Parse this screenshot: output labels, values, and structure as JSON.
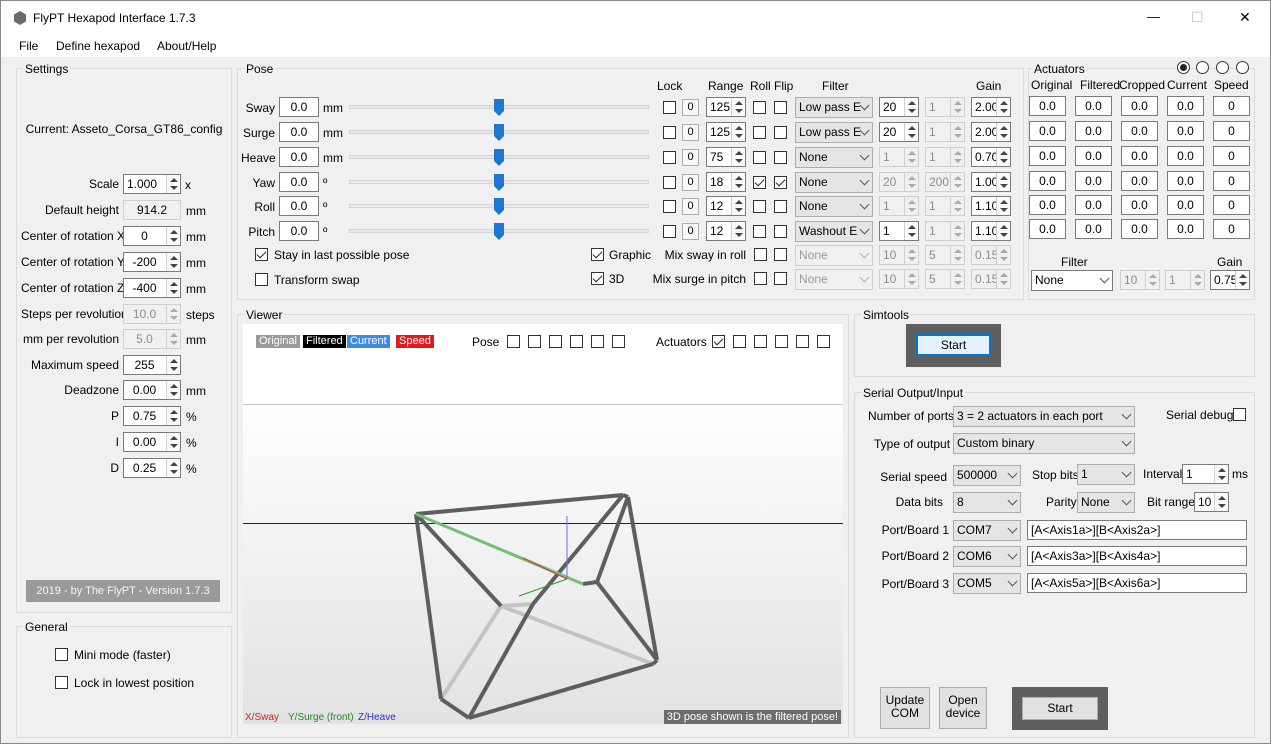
{
  "window": {
    "title": "FlyPT Hexapod Interface 1.7.3",
    "controls": {
      "minimize": "—",
      "maximize": "☐",
      "close": "✕"
    }
  },
  "menu": [
    "File",
    "Define hexapod",
    "About/Help"
  ],
  "settings": {
    "group_label": "Settings",
    "current": "Current: Asseto_Corsa_GT86_config",
    "scale": {
      "label": "Scale",
      "value": "1.000",
      "unit": "x"
    },
    "default_height": {
      "label": "Default height",
      "value": "914.2",
      "unit": "mm"
    },
    "cor_x": {
      "label": "Center of rotation X",
      "value": "0",
      "unit": "mm"
    },
    "cor_y": {
      "label": "Center of rotation Y",
      "value": "-200",
      "unit": "mm"
    },
    "cor_z": {
      "label": "Center of rotation Z",
      "value": "-400",
      "unit": "mm"
    },
    "steps": {
      "label": "Steps per revolution",
      "value": "10.0",
      "unit": "steps"
    },
    "mm_rev": {
      "label": "mm per revolution",
      "value": "5.0",
      "unit": "mm"
    },
    "max_speed": {
      "label": "Maximum speed",
      "value": "255",
      "unit": ""
    },
    "deadzone": {
      "label": "Deadzone",
      "value": "0.00",
      "unit": "mm"
    },
    "p": {
      "label": "P",
      "value": "0.75",
      "unit": "%"
    },
    "i": {
      "label": "I",
      "value": "0.00",
      "unit": "%"
    },
    "d": {
      "label": "D",
      "value": "0.25",
      "unit": "%"
    },
    "footer": "2019 - by The FlyPT - Version 1.7.3"
  },
  "general": {
    "group_label": "General",
    "mini_mode": "Mini mode (faster)",
    "lock_lowest": "Lock in lowest position"
  },
  "pose": {
    "group_label": "Pose",
    "headers": {
      "lock": "Lock",
      "range": "Range",
      "roll": "Roll",
      "flip": "Flip",
      "filter": "Filter",
      "gain": "Gain"
    },
    "rows": [
      {
        "name": "Sway",
        "value": "0.0",
        "unit": "mm",
        "lock": "0",
        "range": "125",
        "roll": false,
        "flip": false,
        "filter": "Low pass E",
        "f1": "20",
        "f2": "1",
        "gain": "2.00",
        "f1_dis": false
      },
      {
        "name": "Surge",
        "value": "0.0",
        "unit": "mm",
        "lock": "0",
        "range": "125",
        "roll": false,
        "flip": false,
        "filter": "Low pass E",
        "f1": "20",
        "f2": "1",
        "gain": "2.00",
        "f1_dis": false
      },
      {
        "name": "Heave",
        "value": "0.0",
        "unit": "mm",
        "lock": "0",
        "range": "75",
        "roll": false,
        "flip": false,
        "filter": "None",
        "f1": "1",
        "f2": "1",
        "gain": "0.70",
        "f1_dis": true
      },
      {
        "name": "Yaw",
        "value": "0.0",
        "unit": "º",
        "lock": "0",
        "range": "18",
        "roll": true,
        "flip": true,
        "filter": "None",
        "f1": "20",
        "f2": "200",
        "gain": "1.00",
        "f1_dis": true
      },
      {
        "name": "Roll",
        "value": "0.0",
        "unit": "º",
        "lock": "0",
        "range": "12",
        "roll": false,
        "flip": false,
        "filter": "None",
        "f1": "1",
        "f2": "1",
        "gain": "1.10",
        "f1_dis": true
      },
      {
        "name": "Pitch",
        "value": "0.0",
        "unit": "º",
        "lock": "0",
        "range": "12",
        "roll": false,
        "flip": false,
        "filter": "Washout E",
        "f1": "1",
        "f2": "1",
        "gain": "1.10",
        "f1_dis": false
      }
    ],
    "stay_last": "Stay in last possible pose",
    "transform_swap": "Transform swap",
    "graphic": "Graphic",
    "three_d": "3D",
    "mix_sway": {
      "label": "Mix sway in roll",
      "filter": "None",
      "f1": "10",
      "f2": "5",
      "gain": "0.15"
    },
    "mix_surge": {
      "label": "Mix surge in pitch",
      "filter": "None",
      "f1": "10",
      "f2": "5",
      "gain": "0.15"
    }
  },
  "actuators": {
    "group_label": "Actuators",
    "headers": [
      "Original",
      "Filtered",
      "Cropped",
      "Current",
      "Speed"
    ],
    "rows": [
      [
        "0.0",
        "0.0",
        "0.0",
        "0.0",
        "0"
      ],
      [
        "0.0",
        "0.0",
        "0.0",
        "0.0",
        "0"
      ],
      [
        "0.0",
        "0.0",
        "0.0",
        "0.0",
        "0"
      ],
      [
        "0.0",
        "0.0",
        "0.0",
        "0.0",
        "0"
      ],
      [
        "0.0",
        "0.0",
        "0.0",
        "0.0",
        "0"
      ],
      [
        "0.0",
        "0.0",
        "0.0",
        "0.0",
        "0"
      ]
    ],
    "filter_label": "Filter",
    "gain_label": "Gain",
    "filter": "None",
    "f1": "10",
    "f2": "1",
    "gain": "0.75"
  },
  "viewer": {
    "group_label": "Viewer",
    "legend": [
      "Original",
      "Filtered",
      "Current",
      "Speed"
    ],
    "pose_label": "Pose",
    "actuators_label": "Actuators",
    "axis_x": "X/Sway",
    "axis_y": "Y/Surge (front)",
    "axis_z": "Z/Heave",
    "note": "3D pose shown is the filtered pose!"
  },
  "simtools": {
    "group_label": "Simtools",
    "start": "Start"
  },
  "serial": {
    "group_label": "Serial Output/Input",
    "ports_label": "Number of ports",
    "ports": "3 = 2 actuators in each port",
    "serial_debug": "Serial debug",
    "type_label": "Type of output",
    "type": "Custom binary",
    "speed_label": "Serial speed",
    "speed": "500000",
    "stop_label": "Stop bits",
    "stop": "1",
    "interval_label": "Interval",
    "interval": "1",
    "interval_unit": "ms",
    "databits_label": "Data bits",
    "databits": "8",
    "parity_label": "Parity",
    "parity": "None",
    "bitrange_label": "Bit range",
    "bitrange": "10",
    "boards": [
      {
        "label": "Port/Board 1",
        "com": "COM7",
        "out": "[A<Axis1a>][B<Axis2a>]"
      },
      {
        "label": "Port/Board 2",
        "com": "COM6",
        "out": "[A<Axis3a>][B<Axis4a>]"
      },
      {
        "label": "Port/Board 3",
        "com": "COM5",
        "out": "[A<Axis5a>][B<Axis6a>]"
      }
    ],
    "update_com": [
      "Update",
      "COM"
    ],
    "open_device": [
      "Open",
      "device"
    ],
    "start": "Start"
  },
  "colors": {
    "original": "#a0a0a0",
    "filtered": "#000000",
    "current": "#3c8ce6",
    "speed": "#e01b1b",
    "slider_thumb": "#1e78d2"
  }
}
